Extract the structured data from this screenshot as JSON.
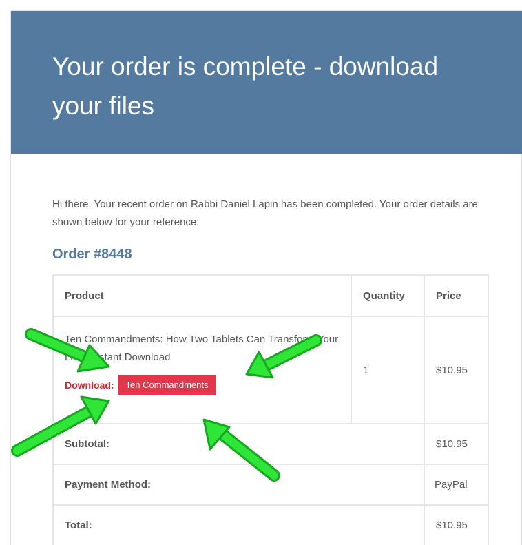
{
  "header": {
    "title": "Your order is complete - download your files"
  },
  "message": {
    "intro": "Hi there. Your recent order on Rabbi Daniel Lapin has been completed. Your order details are shown below for your reference:"
  },
  "order": {
    "heading": "Order #8448",
    "columns": {
      "product": "Product",
      "quantity": "Quantity",
      "price": "Price"
    },
    "item": {
      "name": "Ten Commandments: How Two Tablets Can Transform Your Life - Instant Download",
      "quantity": "1",
      "price": "$10.95",
      "download_label": "Download:",
      "download_button": "Ten Commandments"
    },
    "totals": [
      {
        "label": "Subtotal:",
        "value": "$10.95"
      },
      {
        "label": "Payment Method:",
        "value": "PayPal"
      },
      {
        "label": "Total:",
        "value": "$10.95"
      }
    ]
  },
  "colors": {
    "header_background": "#557a9f",
    "download_button": "#e2374b",
    "download_label": "#d9202b",
    "annotation_arrow": "#22d62b"
  },
  "annotations": {
    "icon": "arrow-icon",
    "count": 4
  }
}
